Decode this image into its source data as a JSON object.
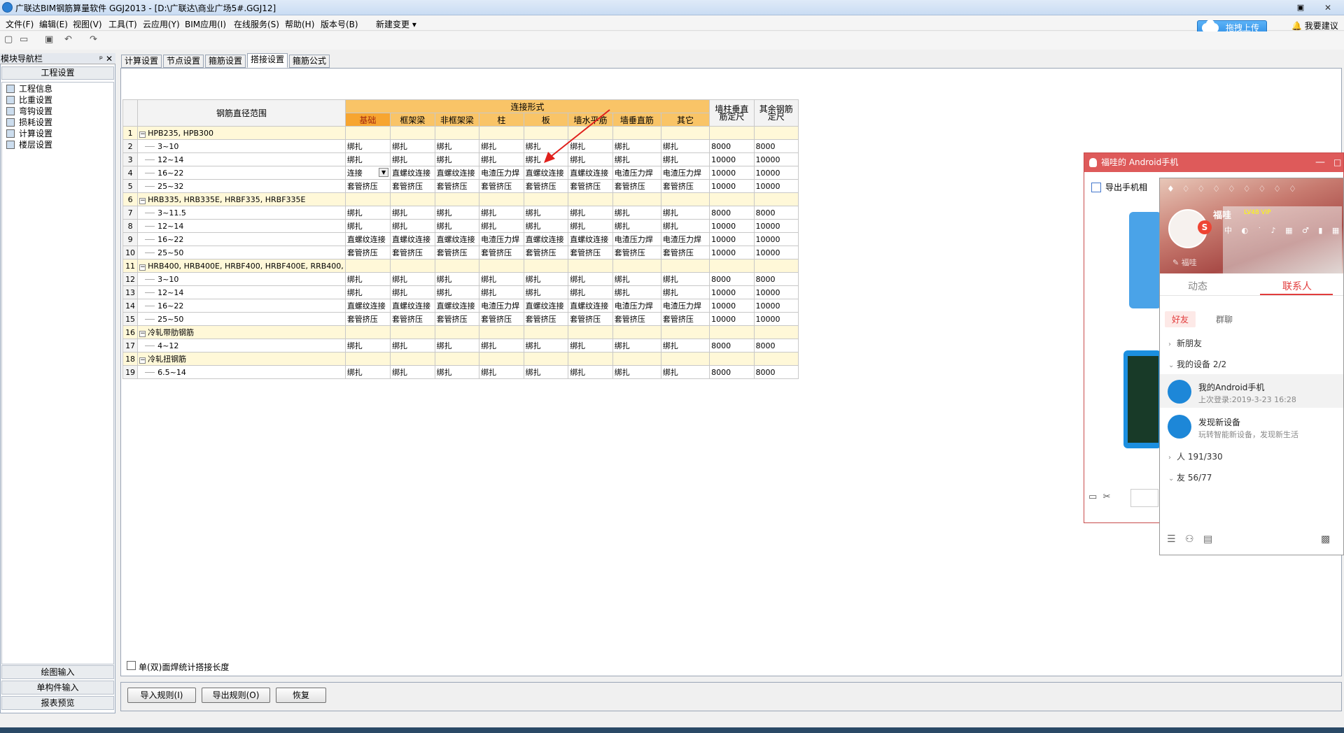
{
  "window": {
    "title": "广联达BIM钢筋算量软件 GGJ2013 - [D:\\广联达\\商业广场5#.GGJ12]",
    "restore": "▣",
    "close": "✕"
  },
  "menu": [
    "文件(F)",
    "编辑(E)",
    "视图(V)",
    "工具(T)",
    "云应用(Y)",
    "BIM应用(I)",
    "在线服务(S)",
    "帮助(H)",
    "版本号(B)",
    "新建变更 ▾"
  ],
  "upload_label": "拖拽上传",
  "suggest_label": "我要建议",
  "nav": {
    "title": "模块导航栏",
    "pin": "ᵖ",
    "close": "✕",
    "header": "工程设置",
    "items": [
      "工程信息",
      "比重设置",
      "弯钩设置",
      "损耗设置",
      "计算设置",
      "楼层设置"
    ],
    "bottom": [
      "绘图输入",
      "单构件输入",
      "报表预览"
    ]
  },
  "tabs": [
    "计算设置",
    "节点设置",
    "箍筋设置",
    "搭接设置",
    "箍筋公式"
  ],
  "grid": {
    "col_range": "钢筋直径范围",
    "col_group": "连接形式",
    "cols": [
      "基础",
      "框架梁",
      "非框架梁",
      "柱",
      "板",
      "墙水平筋",
      "墙垂直筋",
      "其它"
    ],
    "col_wall": "墙柱垂直筋定尺",
    "col_other": "其余钢筋定尺",
    "rows": [
      {
        "n": "1",
        "type": "group",
        "label": "HPB235, HPB300"
      },
      {
        "n": "2",
        "type": "data",
        "label": "3~10",
        "c": [
          "绑扎",
          "绑扎",
          "绑扎",
          "绑扎",
          "绑扎",
          "绑扎",
          "绑扎",
          "绑扎"
        ],
        "w": "8000",
        "o": "8000"
      },
      {
        "n": "3",
        "type": "data",
        "label": "12~14",
        "c": [
          "绑扎",
          "绑扎",
          "绑扎",
          "绑扎",
          "绑扎",
          "绑扎",
          "绑扎",
          "绑扎"
        ],
        "w": "10000",
        "o": "10000"
      },
      {
        "n": "4",
        "type": "data",
        "label": "16~22",
        "c": [
          "连接",
          "直螺纹连接",
          "直螺纹连接",
          "电渣压力焊",
          "直螺纹连接",
          "直螺纹连接",
          "电渣压力焊",
          "电渣压力焊"
        ],
        "w": "10000",
        "o": "10000",
        "sel": true
      },
      {
        "n": "5",
        "type": "data",
        "label": "25~32",
        "c": [
          "套管挤压",
          "套管挤压",
          "套管挤压",
          "套管挤压",
          "套管挤压",
          "套管挤压",
          "套管挤压",
          "套管挤压"
        ],
        "w": "10000",
        "o": "10000"
      },
      {
        "n": "6",
        "type": "group",
        "label": "HRB335, HRB335E, HRBF335, HRBF335E"
      },
      {
        "n": "7",
        "type": "data",
        "label": "3~11.5",
        "c": [
          "绑扎",
          "绑扎",
          "绑扎",
          "绑扎",
          "绑扎",
          "绑扎",
          "绑扎",
          "绑扎"
        ],
        "w": "8000",
        "o": "8000"
      },
      {
        "n": "8",
        "type": "data",
        "label": "12~14",
        "c": [
          "绑扎",
          "绑扎",
          "绑扎",
          "绑扎",
          "绑扎",
          "绑扎",
          "绑扎",
          "绑扎"
        ],
        "w": "10000",
        "o": "10000"
      },
      {
        "n": "9",
        "type": "data",
        "label": "16~22",
        "c": [
          "直螺纹连接",
          "直螺纹连接",
          "直螺纹连接",
          "电渣压力焊",
          "直螺纹连接",
          "直螺纹连接",
          "电渣压力焊",
          "电渣压力焊"
        ],
        "w": "10000",
        "o": "10000"
      },
      {
        "n": "10",
        "type": "data",
        "label": "25~50",
        "c": [
          "套管挤压",
          "套管挤压",
          "套管挤压",
          "套管挤压",
          "套管挤压",
          "套管挤压",
          "套管挤压",
          "套管挤压"
        ],
        "w": "10000",
        "o": "10000"
      },
      {
        "n": "11",
        "type": "group",
        "label": "HRB400, HRB400E, HRBF400, HRBF400E, RRB400,"
      },
      {
        "n": "12",
        "type": "data",
        "label": "3~10",
        "c": [
          "绑扎",
          "绑扎",
          "绑扎",
          "绑扎",
          "绑扎",
          "绑扎",
          "绑扎",
          "绑扎"
        ],
        "w": "8000",
        "o": "8000"
      },
      {
        "n": "13",
        "type": "data",
        "label": "12~14",
        "c": [
          "绑扎",
          "绑扎",
          "绑扎",
          "绑扎",
          "绑扎",
          "绑扎",
          "绑扎",
          "绑扎"
        ],
        "w": "10000",
        "o": "10000"
      },
      {
        "n": "14",
        "type": "data",
        "label": "16~22",
        "c": [
          "直螺纹连接",
          "直螺纹连接",
          "直螺纹连接",
          "电渣压力焊",
          "直螺纹连接",
          "直螺纹连接",
          "电渣压力焊",
          "电渣压力焊"
        ],
        "w": "10000",
        "o": "10000"
      },
      {
        "n": "15",
        "type": "data",
        "label": "25~50",
        "c": [
          "套管挤压",
          "套管挤压",
          "套管挤压",
          "套管挤压",
          "套管挤压",
          "套管挤压",
          "套管挤压",
          "套管挤压"
        ],
        "w": "10000",
        "o": "10000"
      },
      {
        "n": "16",
        "type": "group",
        "label": "冷轧带肋钢筋"
      },
      {
        "n": "17",
        "type": "data",
        "label": "4~12",
        "c": [
          "绑扎",
          "绑扎",
          "绑扎",
          "绑扎",
          "绑扎",
          "绑扎",
          "绑扎",
          "绑扎"
        ],
        "w": "8000",
        "o": "8000"
      },
      {
        "n": "18",
        "type": "group",
        "label": "冷轧扭钢筋"
      },
      {
        "n": "19",
        "type": "data",
        "label": "6.5~14",
        "c": [
          "绑扎",
          "绑扎",
          "绑扎",
          "绑扎",
          "绑扎",
          "绑扎",
          "绑扎",
          "绑扎"
        ],
        "w": "8000",
        "o": "8000"
      }
    ]
  },
  "weld_option": "单(双)面焊统计搭接长度",
  "buttons": [
    "导入规则(I)",
    "导出规则(O)",
    "恢复"
  ],
  "qq": {
    "title": "福哇的 Android手机",
    "min": "—",
    "close": "□",
    "toolbar": "导出手机相",
    "nick": "福哇",
    "svip": "LV48 VIP",
    "sign": "✎ 福哇",
    "tabs": [
      "动态",
      "联系人"
    ],
    "subtabs": [
      "好友",
      "群聊"
    ],
    "groups": [
      "新朋友",
      "我的设备 2/2"
    ],
    "devices": [
      {
        "name": "我的Android手机",
        "sub": "上次登录:2019-3-23 16:28"
      },
      {
        "name": "发现新设备",
        "sub": "玩转智能新设备，发现新生活"
      }
    ],
    "groups2": [
      "人 191/330",
      "友 56/77"
    ]
  },
  "colors": {
    "accent": "#e23c3c",
    "header_orange": "#f9c467",
    "group_yellow": "#fff8d8"
  }
}
